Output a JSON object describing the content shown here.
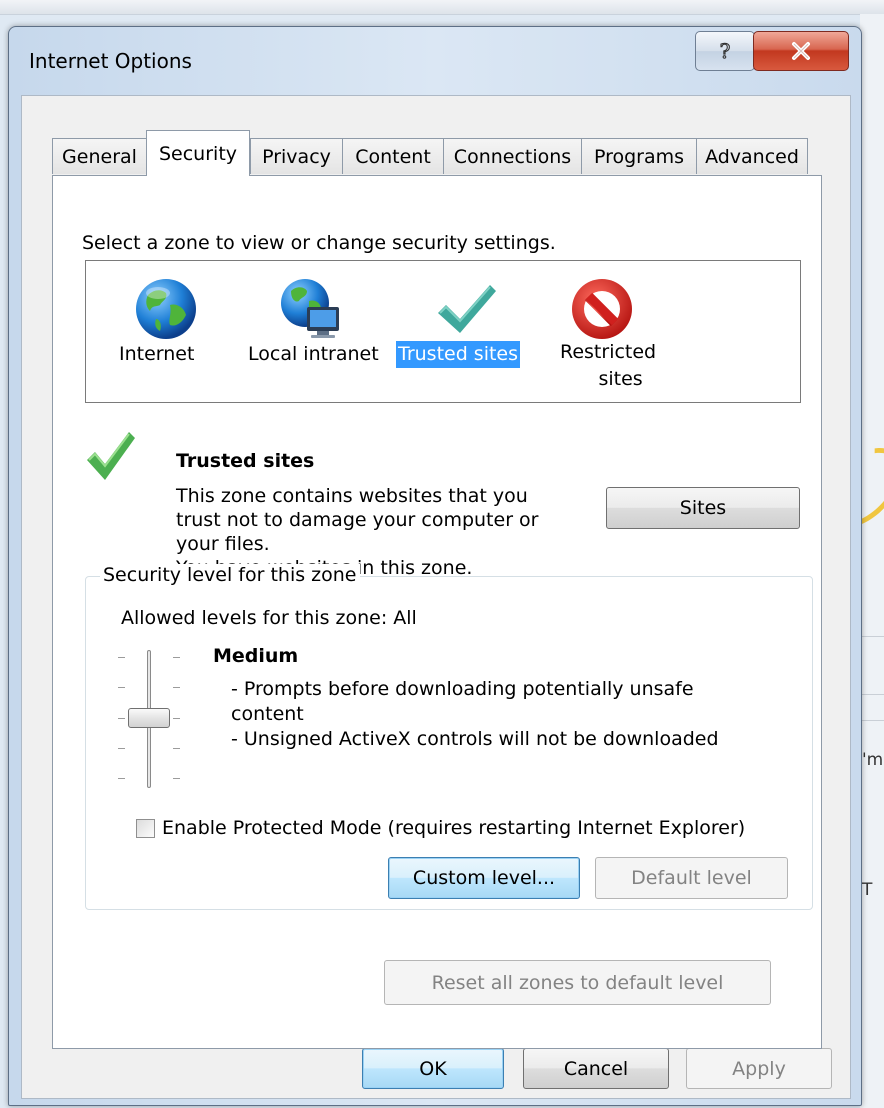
{
  "window": {
    "title": "Internet Options"
  },
  "tabs": [
    "General",
    "Security",
    "Privacy",
    "Content",
    "Connections",
    "Programs",
    "Advanced"
  ],
  "active_tab": "Security",
  "zones": {
    "prompt": "Select a zone to view or change security settings.",
    "items": [
      {
        "name": "Internet",
        "icon": "globe-icon"
      },
      {
        "name": "Local intranet",
        "icon": "intranet-globe-icon"
      },
      {
        "name": "Trusted sites",
        "icon": "checkmark-icon",
        "selected": true
      },
      {
        "name_line1": "Restricted",
        "name_line2": "sites",
        "icon": "restricted-icon"
      }
    ]
  },
  "zone_info": {
    "title": "Trusted sites",
    "desc_line1": "This zone contains websites that you",
    "desc_line2": "trust not to damage your computer or",
    "desc_line3": "your files.",
    "desc_line4": "You have websites in this zone.",
    "sites_button": "Sites"
  },
  "security_level": {
    "legend": "Security level for this zone",
    "allowed": "Allowed levels for this zone: All",
    "level": "Medium",
    "bullet1_line1": "- Prompts before downloading potentially unsafe",
    "bullet1_line2": "content",
    "bullet2": "- Unsigned ActiveX controls will not be downloaded",
    "protected_mode_label": "Enable Protected Mode (requires restarting Internet Explorer)",
    "protected_mode_checked": false,
    "custom_level_button": "Custom level...",
    "default_level_button": "Default level"
  },
  "reset_button": "Reset all zones to default level",
  "footer": {
    "ok": "OK",
    "cancel": "Cancel",
    "apply": "Apply"
  },
  "background": {
    "fragment1": "'m",
    "fragment2": "T"
  },
  "colors": {
    "selection": "#3399ff",
    "check_green": "#4caf50",
    "trusted_teal": "#3fa89c",
    "restricted_red": "#d0201e",
    "close_red": "#c8452c"
  }
}
